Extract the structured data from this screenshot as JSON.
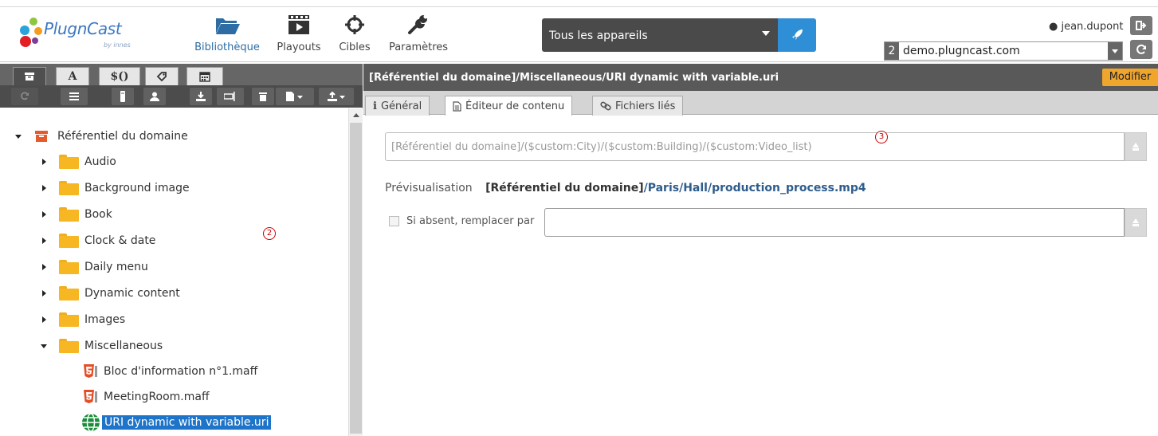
{
  "app": {
    "logo_text": "PlugnCast",
    "logo_sub": "by innes"
  },
  "nav": [
    {
      "label": "Bibliothèque",
      "icon": "folder-open-icon",
      "active": true
    },
    {
      "label": "Playouts",
      "icon": "film-clapper-icon",
      "active": false
    },
    {
      "label": "Cibles",
      "icon": "crosshair-icon",
      "active": false
    },
    {
      "label": "Paramètres",
      "icon": "wrench-icon",
      "active": false
    }
  ],
  "devices": {
    "selected": "Tous les appareils"
  },
  "user": {
    "name": "jean.dupont"
  },
  "domain": {
    "number": "2",
    "value": "demo.plugncast.com"
  },
  "left_tabs": [
    {
      "label": "",
      "icon": "archive-icon",
      "active": true
    },
    {
      "label": "A",
      "icon": "",
      "active": false
    },
    {
      "label": "$()",
      "icon": "",
      "active": false
    },
    {
      "label": "",
      "icon": "tag-icon",
      "active": false
    },
    {
      "label": "",
      "icon": "calendar-icon",
      "active": false
    }
  ],
  "toolbar_icons": [
    "refresh-icon",
    "list-icon",
    "usb-icon",
    "user-icon",
    "download-icon",
    "rename-icon",
    "trash-icon",
    "new-file-icon",
    "upload-icon"
  ],
  "tree": {
    "root": "Référentiel du domaine",
    "folders": [
      "Audio",
      "Background image",
      "Book",
      "Clock & date",
      "Daily menu",
      "Dynamic content",
      "Images",
      "Miscellaneous"
    ],
    "files": [
      "Bloc d'information n°1.maff",
      "MeetingRoom.maff",
      "URI dynamic with variable.uri"
    ]
  },
  "markers": {
    "m2": "2",
    "m3": "3"
  },
  "content": {
    "path": "[Référentiel du domaine]/Miscellaneous/URI dynamic with variable.uri",
    "modify_label": "Modifier",
    "tabs": [
      {
        "label": "Général",
        "icon": "info-icon",
        "active": false
      },
      {
        "label": "Éditeur de contenu",
        "icon": "document-icon",
        "active": true
      },
      {
        "label": "Fichiers liés",
        "icon": "link-icon",
        "active": false
      }
    ],
    "uri_value": "[Référentiel du domaine]/($custom:City)/($custom:Building)/($custom:Video_list)",
    "preview_label": "Prévisualisation",
    "preview_prefix": "[Référentiel du domaine]",
    "preview_path": "/Paris/Hall/production_process.mp4",
    "fallback_label": "Si absent, remplacer par",
    "fallback_value": ""
  },
  "colors": {
    "accent": "#2f8fd6",
    "highlight": "#1e74c8",
    "modify": "#f0a52c",
    "folder": "#f7b723"
  }
}
